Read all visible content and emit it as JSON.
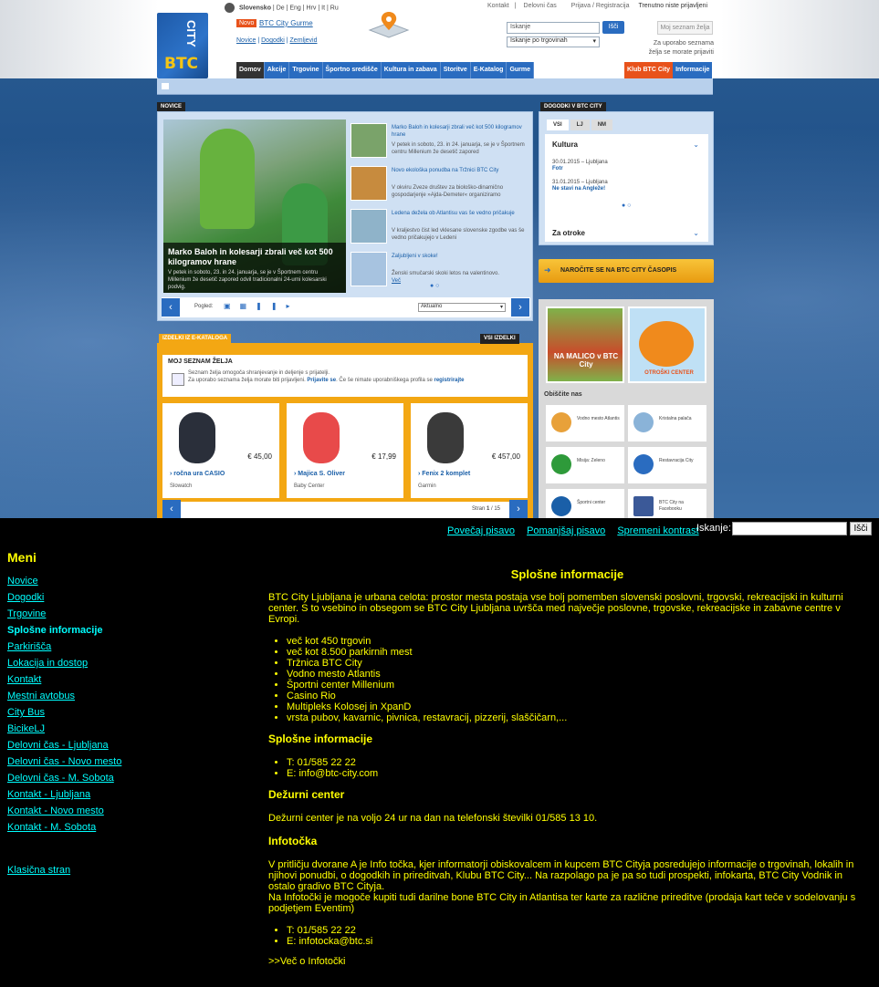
{
  "header": {
    "languages_active": "Slovensko",
    "languages_other": [
      "De",
      "Eng",
      "Hrv",
      "It",
      "Ru"
    ],
    "novo_badge": "Novo",
    "gurme_link": "BTC City Gurme",
    "sublinks": [
      "Novice",
      "Dogodki",
      "Zemljevid"
    ],
    "top_links": [
      "Kontakt",
      "Delovni čas",
      "Prijava / Registracija"
    ],
    "login_status": "Trenutno niste prijavljeni",
    "search_placeholder": "Iskanje",
    "search_button": "Išči",
    "search_scope": "Iskanje po trgovinah",
    "wishlist_button": "Moj seznam želja",
    "wishlist_note": "Za uporabo seznama želja se morate prijaviti",
    "nav": [
      "Domov",
      "Akcije",
      "Trgovine",
      "Športno središče",
      "Kultura in zabava",
      "Storitve",
      "E-Katalog",
      "Gurme"
    ],
    "nav_right": [
      "Klub BTC City",
      "Informacije"
    ],
    "logo_btc": "BTC",
    "logo_city": "CITY"
  },
  "novice": {
    "title": "NOVICE",
    "main_title": "Marko Baloh in kolesarji zbrali več kot 500 kilogramov hrane",
    "main_desc": "V petek in soboto, 23. in 24. januarja, se je v Športnem centru Millenium že desetič zapored odvil tradicionalni 24-urni kolesarski podvig.",
    "items": [
      {
        "title": "Marko Baloh in kolesarji zbrali več kot 500 kilogramov hrane",
        "desc": "V petek in soboto, 23. in 24. januarja, se je v Športnem centru Millenium že desetič zapored"
      },
      {
        "title": "Novo ekološka ponudba na Tržnici BTC City",
        "desc": "V okviru Zveze društev za biološko-dinamično gospodarjenje »Ajda-Demeter« organiziramo"
      },
      {
        "title": "Ledena dežela ob Atlantisu vas še vedno pričakuje",
        "desc": "V kraljestvo čist led vklesane slovenske zgodbe vas še vedno pričakujejo v Ledeni"
      },
      {
        "title": "Zaljubljeni v skoke!",
        "desc": "Ženski smučarski skoki letos na valentinovo.",
        "more": "Več"
      }
    ],
    "view_label": "Pogled:",
    "sort_select": "Aktualno"
  },
  "ekatalog": {
    "title": "IZDELKI IZ E-KATALOGA",
    "all_link": "VSI IZDELKI",
    "wish_title": "MOJ SEZNAM ŽELJA",
    "wish_text1": "Seznam želja omogoča shranjevanje in deljenje s prijatelji.",
    "wish_text2": "Za uporabo seznama želja morate biti prijavljeni.",
    "wish_login": "Prijavite se",
    "wish_text3": ". Če še nimate uporabniškega profila se",
    "wish_register": "registrirajte",
    "products": [
      {
        "price": "€ 45,00",
        "name": "ročna ura CASIO",
        "shop": "Slowatch",
        "color": "#2a2f3a"
      },
      {
        "price": "€ 17,99",
        "name": "Majica S. Oliver",
        "shop": "Baby Center",
        "color": "#e84a4a"
      },
      {
        "price": "€ 457,00",
        "name": "Fenix 2 komplet",
        "shop": "Garmin",
        "color": "#3a3a3a"
      }
    ],
    "page_label": "Stran",
    "page_current": "1",
    "page_total": "/ 15"
  },
  "dogodki": {
    "title": "DOGODKI V BTC CITY",
    "tabs": [
      "VSI",
      "LJ",
      "NM"
    ],
    "category": "Kultura",
    "events": [
      {
        "date": "30.01.2015 – Ljubljana",
        "name": "Fotr"
      },
      {
        "date": "31.01.2015 – Ljubljana",
        "name": "Ne stavi na Angleže!"
      }
    ],
    "category2": "Za otroke",
    "casopis": "NAROČITE SE NA BTC CITY ČASOPIS"
  },
  "ads": {
    "ad1": "NA MALICO v BTC City",
    "ad2": "OTROŠKI CENTER",
    "obiscite": "Obiščite nas",
    "partners": [
      {
        "name": "Vodno mesto Atlantis",
        "color": "#e8a13a"
      },
      {
        "name": "Kristalna palača",
        "color": "#8ab3d8"
      },
      {
        "name": "Misija: Zeleno",
        "color": "#2e9a3a"
      },
      {
        "name": "Restavracija City",
        "color": "#2a6cc0"
      },
      {
        "name": "Športni center",
        "color": "#1a5fa8"
      },
      {
        "name": "BTC City na Facebooku",
        "color": "#3b5998"
      }
    ]
  },
  "access": {
    "links": [
      "Povečaj pisavo",
      "Pomanjšaj pisavo",
      "Spremeni kontrast"
    ],
    "search_label": "Iskanje:",
    "search_button": "Išči"
  },
  "menu": {
    "title": "Meni",
    "items": [
      "Novice",
      "Dogodki",
      "Trgovine",
      "Splošne informacije",
      "Parkirišča",
      "Lokacija in dostop",
      "Kontakt",
      "Mestni avtobus",
      "City Bus",
      "BicikeLJ",
      "Delovni čas - Ljubljana",
      "Delovni čas - Novo mesto",
      "Delovni čas - M. Sobota",
      "Kontakt - Ljubljana",
      "Kontakt - Novo mesto",
      "Kontakt - M. Sobota"
    ],
    "active": "Splošne informacije",
    "classic": "Klasična stran"
  },
  "content": {
    "title": "Splošne informacije",
    "intro": "BTC City Ljubljana je urbana celota:  prostor mesta postaja vse bolj pomemben slovenski poslovni, trgovski, rekreacijski in kulturni center. S to vsebino in obsegom se BTC City Ljubljana uvršča med največje poslovne, trgovske, rekreacijske in zabavne centre v Evropi.",
    "facts": [
      "več kot 450 trgovin",
      "več kot 8.500 parkirnih mest",
      "Tržnica BTC City",
      "Vodno mesto Atlantis",
      "Športni center Millenium",
      "Casino Rio",
      "Multipleks Kolosej in XpanD",
      "vrsta pubov, kavarnic, pivnica, restavracij, pizzerij, slaščičarn,..."
    ],
    "h_general": "Splošne informacije",
    "general": [
      "T: 01/585 22 22",
      "E: info@btc-city.com"
    ],
    "h_duty": "Dežurni center",
    "duty": "Dežurni center je na voljo 24 ur na dan na telefonski številki 01/585 13 10.",
    "h_info": "Infotočka",
    "info1": "V pritličju dvorane A je Info točka, kjer informatorji obiskovalcem in kupcem BTC Cityja posredujejo informacije o trgovinah, lokalih in njihovi ponudbi, o dogodkih in prireditvah, Klubu BTC City... Na razpolago pa je pa so tudi prospekti, infokarta, BTC City Vodnik in ostalo gradivo BTC Cityja.",
    "info2": "Na Infotočki je mogoče kupiti tudi darilne bone BTC City in Atlantisa ter karte za različne prireditve (prodaja kart teče v sodelovanju s podjetjem Eventim)",
    "info_contacts": [
      "T: 01/585 22 22",
      "E: infotocka@btc.si"
    ],
    "more": ">>Več o Infotočki"
  }
}
